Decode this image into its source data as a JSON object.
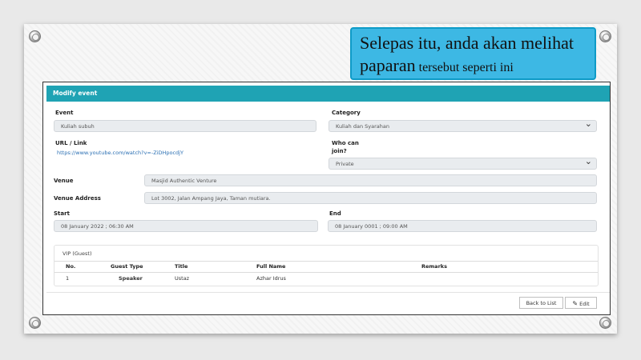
{
  "callout": {
    "line1": "Selepas itu, anda akan melihat",
    "line2_big": "paparan",
    "line2_small": " tersebut seperti ini"
  },
  "header": {
    "title": "Modify event"
  },
  "form": {
    "event_label": "Event",
    "event_value": "Kuliah subuh",
    "category_label": "Category",
    "category_value": "Kuliah dan Syarahan",
    "url_label": "URL / Link",
    "url_value": "https://www.youtube.com/watch?v=-ZiDHpocdjY",
    "who_label_1": "Who can",
    "who_label_2": "join?",
    "who_value": "Private",
    "venue_label": "Venue",
    "venue_value": "Masjid Authentic Venture",
    "address_label": "Venue Address",
    "address_value": "Lot 3002, Jalan Ampang Jaya, Taman mutiara.",
    "start_label": "Start",
    "start_value": "08 January 2022 ; 06:30 AM",
    "end_label": "End",
    "end_value": "08 January 0001 ; 09:00 AM"
  },
  "vip": {
    "title": "VIP (Guest)",
    "columns": [
      "No.",
      "Guest Type",
      "Title",
      "Full Name",
      "Remarks"
    ],
    "rows": [
      {
        "no": "1",
        "type": "Speaker",
        "title": "Ustaz",
        "name": "Azhar Idrus",
        "remarks": ""
      }
    ]
  },
  "buttons": {
    "back": "Back to List",
    "edit": "Edit"
  }
}
